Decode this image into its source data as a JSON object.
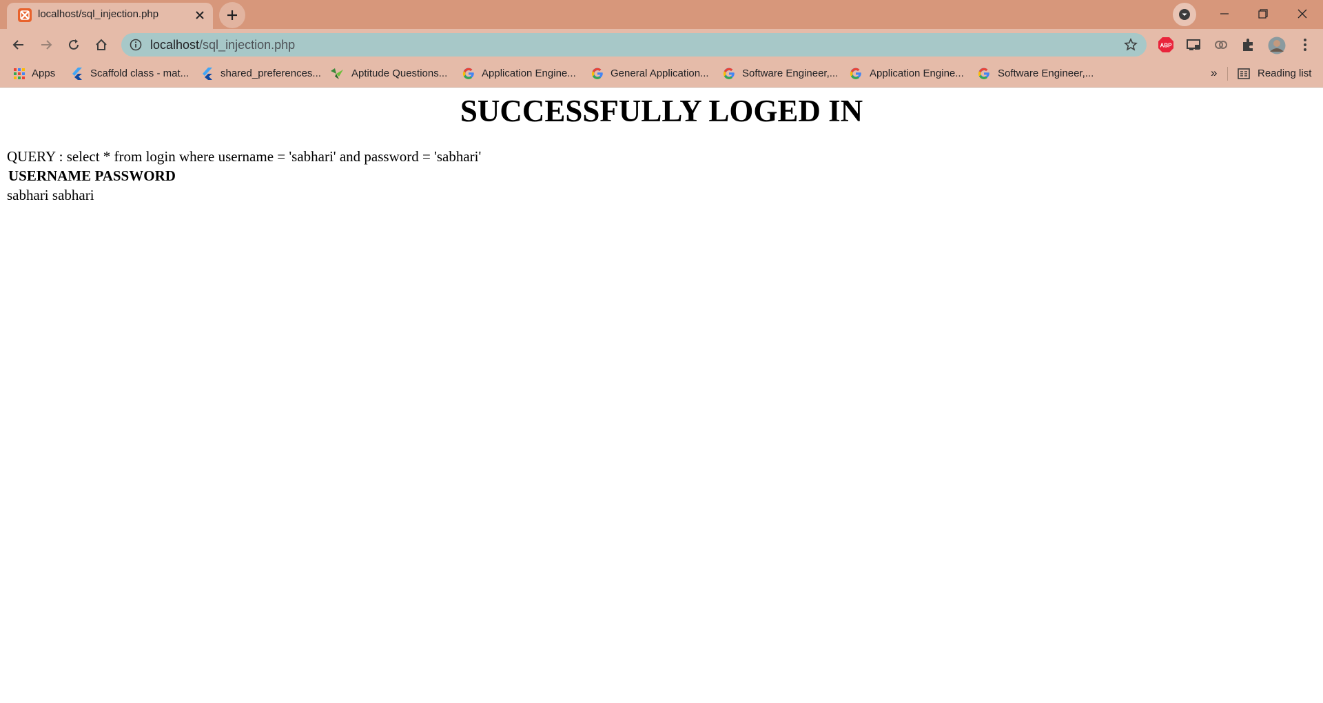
{
  "browser": {
    "tab_title": "localhost/sql_injection.php",
    "url_host": "localhost",
    "url_path": "/sql_injection.php",
    "accent_color": "#d7977b",
    "toolbar_color": "#e5bba9",
    "omnibox_color": "#a7c8c8"
  },
  "bookmarks": {
    "items": [
      {
        "label": "Apps",
        "icon": "apps-grid-icon"
      },
      {
        "label": "Scaffold class - mat...",
        "icon": "flutter-icon"
      },
      {
        "label": "shared_preferences...",
        "icon": "flutter-icon"
      },
      {
        "label": "Aptitude Questions...",
        "icon": "bird-icon"
      },
      {
        "label": "Application Engine...",
        "icon": "google-icon"
      },
      {
        "label": "General Application...",
        "icon": "google-icon"
      },
      {
        "label": "Software Engineer,...",
        "icon": "google-icon"
      },
      {
        "label": "Application Engine...",
        "icon": "google-icon"
      },
      {
        "label": "Software Engineer,...",
        "icon": "google-icon"
      }
    ],
    "overflow": "»",
    "reading_list": "Reading list"
  },
  "page": {
    "heading": "SUCCESSFULLY LOGED IN",
    "query": "QUERY : select * from login where username = 'sabhari' and password = 'sabhari'",
    "table": {
      "headers": [
        "USERNAME",
        "PASSWORD"
      ],
      "rows": [
        [
          "sabhari",
          "sabhari"
        ]
      ]
    }
  }
}
